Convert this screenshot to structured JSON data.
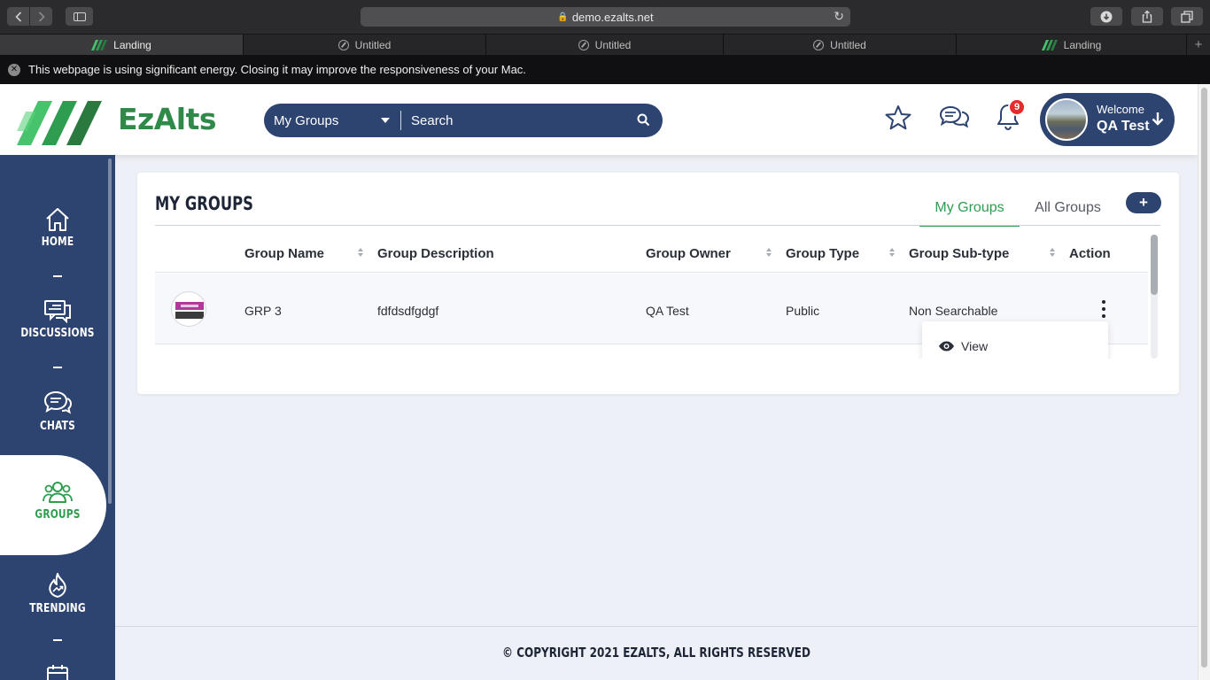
{
  "browser": {
    "url": "demo.ezalts.net",
    "tabs": [
      {
        "label": "Landing",
        "active": true,
        "icon": "ezalts-favicon"
      },
      {
        "label": "Untitled",
        "active": false,
        "icon": "compass-icon"
      },
      {
        "label": "Untitled",
        "active": false,
        "icon": "compass-icon"
      },
      {
        "label": "Untitled",
        "active": false,
        "icon": "compass-icon"
      },
      {
        "label": "Landing",
        "active": false,
        "icon": "ezalts-favicon"
      }
    ],
    "tab_add": "+",
    "energy_warning": "This webpage is using significant energy. Closing it may improve the responsiveness of your Mac."
  },
  "header": {
    "logo_text": "EzAlts",
    "search": {
      "scope": "My Groups",
      "placeholder": "Search"
    },
    "notification_count": "9",
    "user": {
      "welcome": "Welcome",
      "name": "QA Test"
    }
  },
  "sidebar": {
    "items": [
      {
        "label": "HOME",
        "icon": "home-icon"
      },
      {
        "label": "DISCUSSIONS",
        "icon": "discussions-icon"
      },
      {
        "label": "CHATS",
        "icon": "chat-icon"
      },
      {
        "label": "GROUPS",
        "icon": "groups-icon",
        "active": true
      },
      {
        "label": "TRENDING",
        "icon": "trending-icon"
      }
    ]
  },
  "main": {
    "title": "MY GROUPS",
    "tabs": [
      {
        "label": "My Groups",
        "active": true
      },
      {
        "label": "All Groups",
        "active": false
      }
    ],
    "add_label": "+",
    "table": {
      "columns": [
        "Group Name",
        "Group Description",
        "Group Owner",
        "Group Type",
        "Group Sub-type",
        "Action"
      ],
      "rows": [
        {
          "name": "GRP 3",
          "description": "fdfdsdfgdgf",
          "owner": "QA Test",
          "type": "Public",
          "subtype": "Non Searchable"
        }
      ]
    },
    "action_menu": {
      "items": [
        {
          "label": "View",
          "icon": "eye-icon"
        }
      ]
    }
  },
  "footer": {
    "copyright": "© COPYRIGHT 2021 EZALTS, ALL RIGHTS RESERVED"
  },
  "colors": {
    "brand_navy": "#2d4370",
    "brand_green": "#2f9d4f",
    "badge_red": "#e52b2b"
  }
}
